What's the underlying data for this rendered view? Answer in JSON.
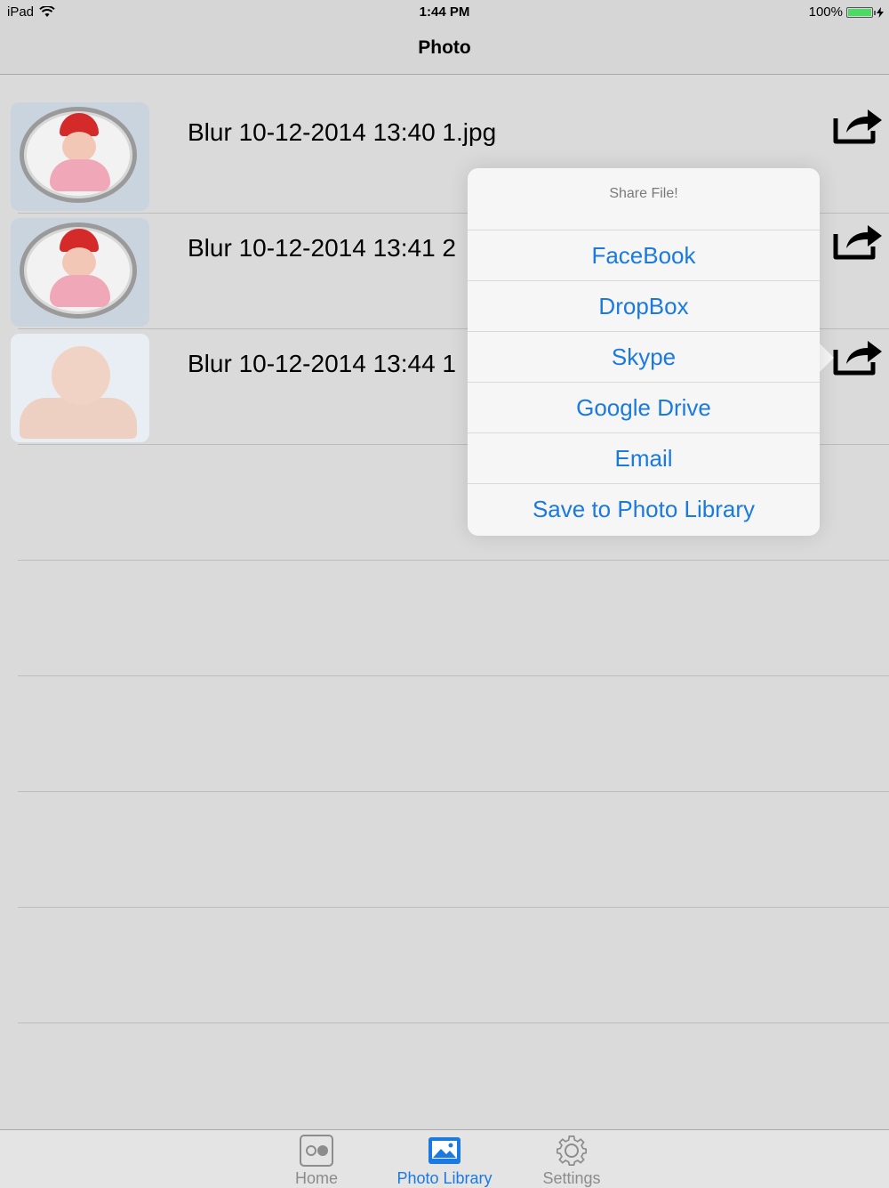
{
  "status_bar": {
    "device": "iPad",
    "time": "1:44 PM",
    "battery": "100%",
    "battery_level": 1.0
  },
  "nav": {
    "title": "Photo"
  },
  "files": [
    {
      "name": "Blur 10-12-2014 13:40 1.jpg",
      "thumb": "baby-santa-hat"
    },
    {
      "name": "Blur 10-12-2014 13:41 2",
      "thumb": "baby-santa-hat"
    },
    {
      "name": "Blur 10-12-2014 13:44 1",
      "thumb": "baby-crawling"
    }
  ],
  "share_icon": "share-icon",
  "popover": {
    "title": "Share File!",
    "options": [
      "FaceBook",
      "DropBox",
      "Skype",
      "Google Drive",
      "Email",
      "Save to Photo Library"
    ],
    "option_color": "#1a7ae0"
  },
  "tabs": [
    {
      "label": "Home",
      "icon": "home-tab-icon",
      "active": false
    },
    {
      "label": "Photo Library",
      "icon": "photo-library-icon",
      "active": true
    },
    {
      "label": "Settings",
      "icon": "gear-icon",
      "active": false
    }
  ],
  "colors": {
    "accent": "#1a7ae0",
    "background": "#dadada"
  }
}
